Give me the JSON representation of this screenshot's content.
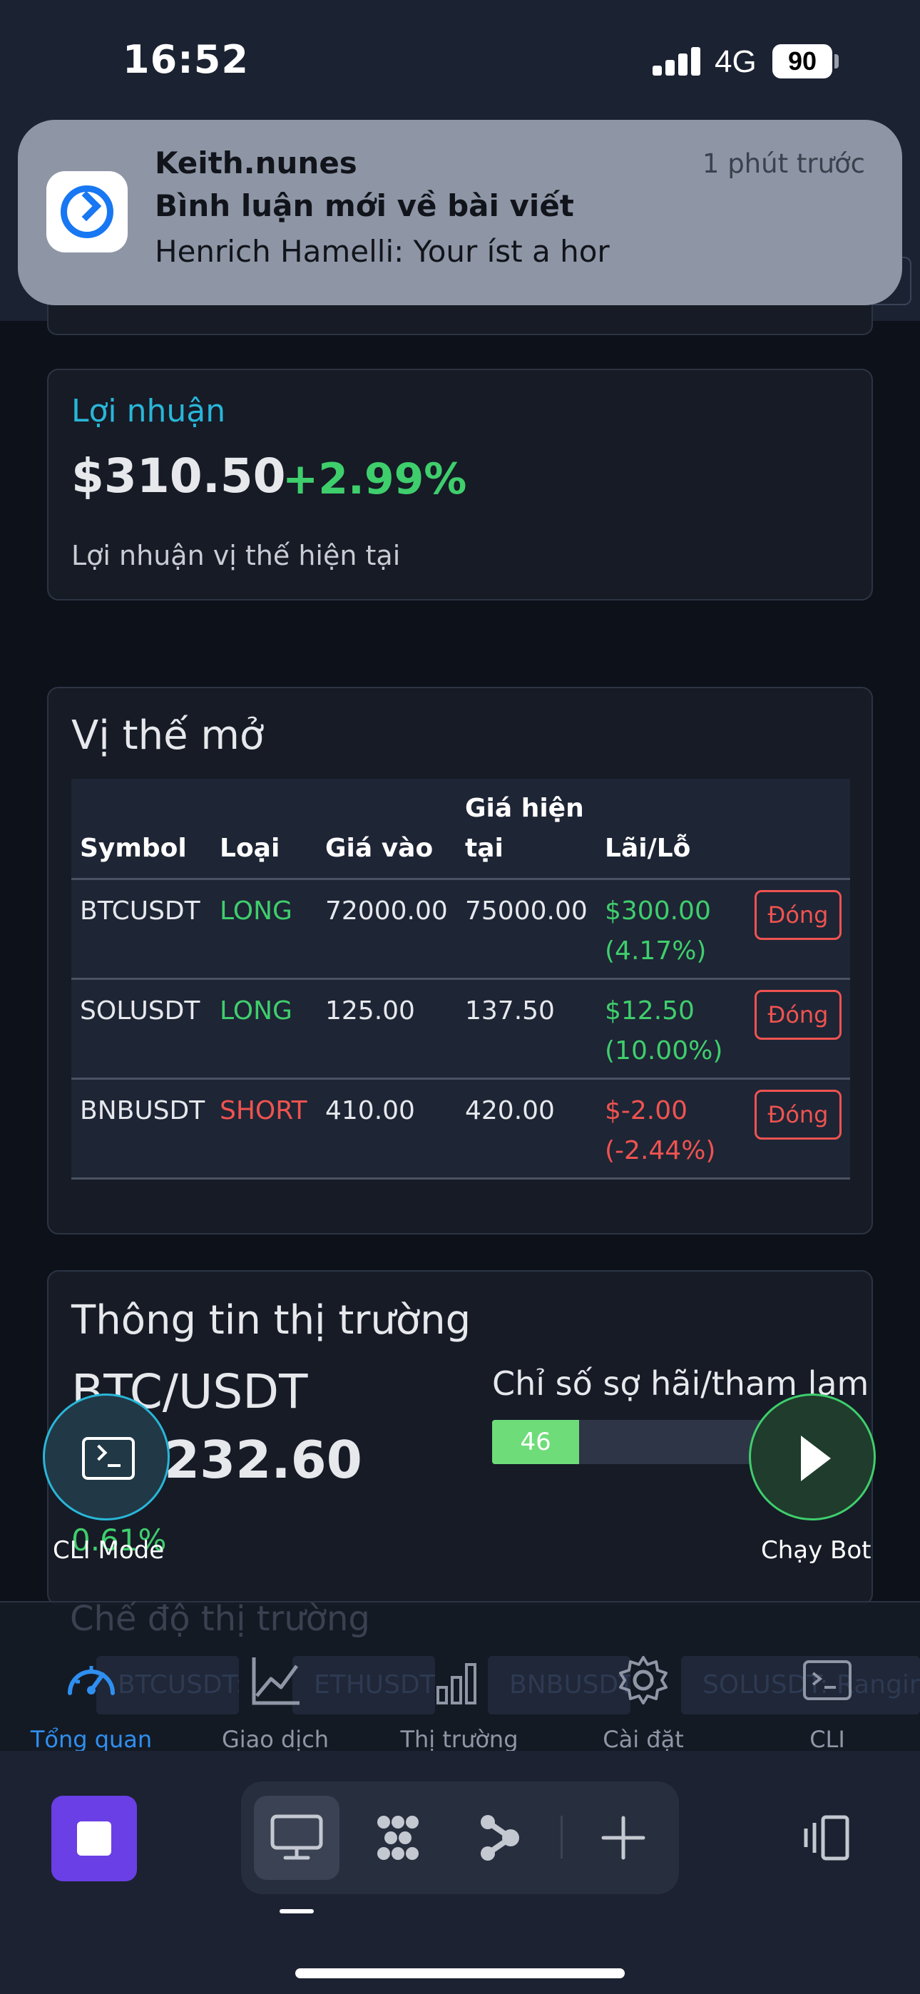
{
  "status_bar": {
    "time": "16:52",
    "network": "4G",
    "battery": "90"
  },
  "notification": {
    "app": "Keith.nunes",
    "time": "1 phút trước",
    "title": "Bình luận mới về bài viết",
    "body": "Henrich Hamelli: Your íst a hor"
  },
  "profit": {
    "label": "Lợi nhuận",
    "value": "$310.50",
    "percent": "+2.99%",
    "description": "Lợi nhuận vị thế hiện tại"
  },
  "positions": {
    "title": "Vị thế mở",
    "headers": [
      "Symbol",
      "Loại",
      "Giá vào",
      "Giá hiện tại",
      "Lãi/Lỗ"
    ],
    "header_current_line1": "Giá hiện",
    "header_current_line2": "tại",
    "close_label": "Đóng",
    "rows": [
      {
        "symbol": "BTCUSDT",
        "type": "LONG",
        "entry": "72000.00",
        "current": "75000.00",
        "pnl": "$300.00",
        "pnl_pct": "(4.17%)"
      },
      {
        "symbol": "SOLUSDT",
        "type": "LONG",
        "entry": "125.00",
        "current": "137.50",
        "pnl": "$12.50",
        "pnl_pct": "(10.00%)"
      },
      {
        "symbol": "BNBUSDT",
        "type": "SHORT",
        "entry": "410.00",
        "current": "420.00",
        "pnl": "$-2.00",
        "pnl_pct": "(-2.44%)"
      }
    ]
  },
  "market": {
    "title": "Thông tin thị trường",
    "pair": "BTC/USDT",
    "price_partial": "232.60",
    "change_partial": "0.61%",
    "fear_greed_label": "Chỉ số sợ hãi/tham lam",
    "fear_greed_value": "46",
    "fear_greed_fraction": 0.46,
    "mode_title": "Chế độ thị trường",
    "tickers": [
      "BTCUSDT: Tăng",
      "ETHUSDT: T",
      "BNBUSDT: Ta",
      "SOLUSDT: Ranging"
    ]
  },
  "fabs": {
    "cli_label": "CLI Mode",
    "bot_label": "Chạy Bot"
  },
  "nav": {
    "items": [
      {
        "label": "Tổng quan",
        "icon": "gauge-icon"
      },
      {
        "label": "Giao dịch",
        "icon": "line-chart-icon"
      },
      {
        "label": "Thị trường",
        "icon": "bar-chart-icon"
      },
      {
        "label": "Cài đặt",
        "icon": "gear-icon"
      },
      {
        "label": "CLI",
        "icon": "terminal-icon"
      }
    ]
  },
  "colors": {
    "accent_blue": "#2f8ff0",
    "profit_green": "#3fce6c",
    "loss_red": "#ef5350",
    "title_cyan": "#29b6d8"
  }
}
